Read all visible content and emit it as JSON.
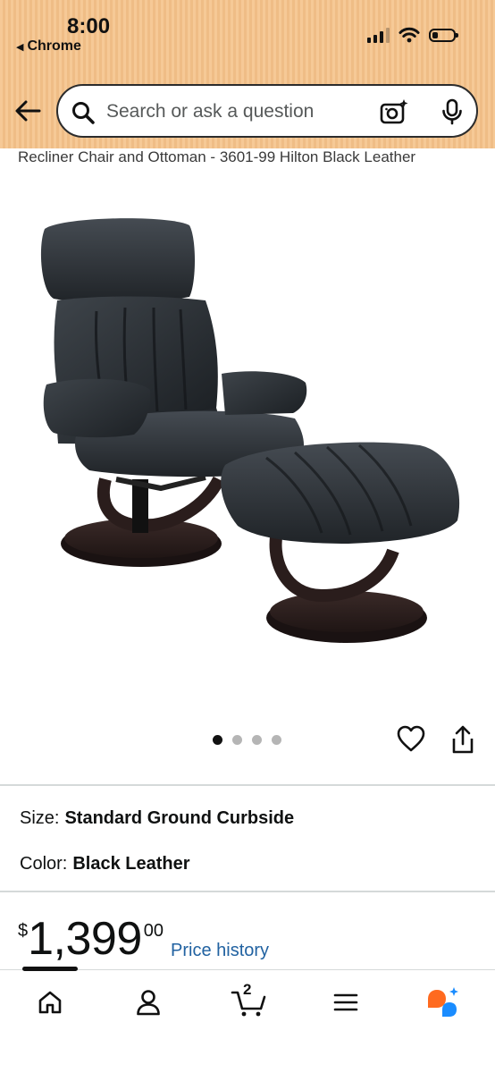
{
  "status_bar": {
    "time": "8:00",
    "back_app": "Chrome",
    "back_glyph": "◀",
    "icons": [
      "cellular-signal-icon",
      "wifi-icon",
      "battery-icon"
    ],
    "battery_level": 0.25
  },
  "search": {
    "placeholder": "Search or ask a question",
    "value": "",
    "icons": [
      "back-arrow-icon",
      "search-icon",
      "camera-icon",
      "microphone-icon"
    ]
  },
  "product": {
    "title": "Recliner Chair and Ottoman - 3601-99 Hilton Black Leather",
    "image_alt": "Black leather swivel recliner chair with matching ottoman on dark wood bases",
    "carousel": {
      "count": 4,
      "active_index": 0
    },
    "actions": [
      "wishlist-heart-icon",
      "share-icon"
    ],
    "options": [
      {
        "label": "Size:",
        "value": "Standard Ground Curbside"
      },
      {
        "label": "Color:",
        "value": "Black Leather"
      }
    ],
    "price": {
      "symbol": "$",
      "whole": "1,399",
      "fraction": "00"
    },
    "price_history_label": "Price history"
  },
  "bottom_nav": {
    "items": [
      "home-icon",
      "account-icon",
      "cart-icon",
      "menu-icon",
      "ai-assistant-icon"
    ],
    "cart_count": "2"
  },
  "colors": {
    "header_bg": "#f6c996",
    "link": "#2162a1",
    "text": "#0f1111",
    "divider": "#d5d9d9",
    "assistant_orange": "#ff6a1f",
    "assistant_blue": "#1a8cff"
  }
}
